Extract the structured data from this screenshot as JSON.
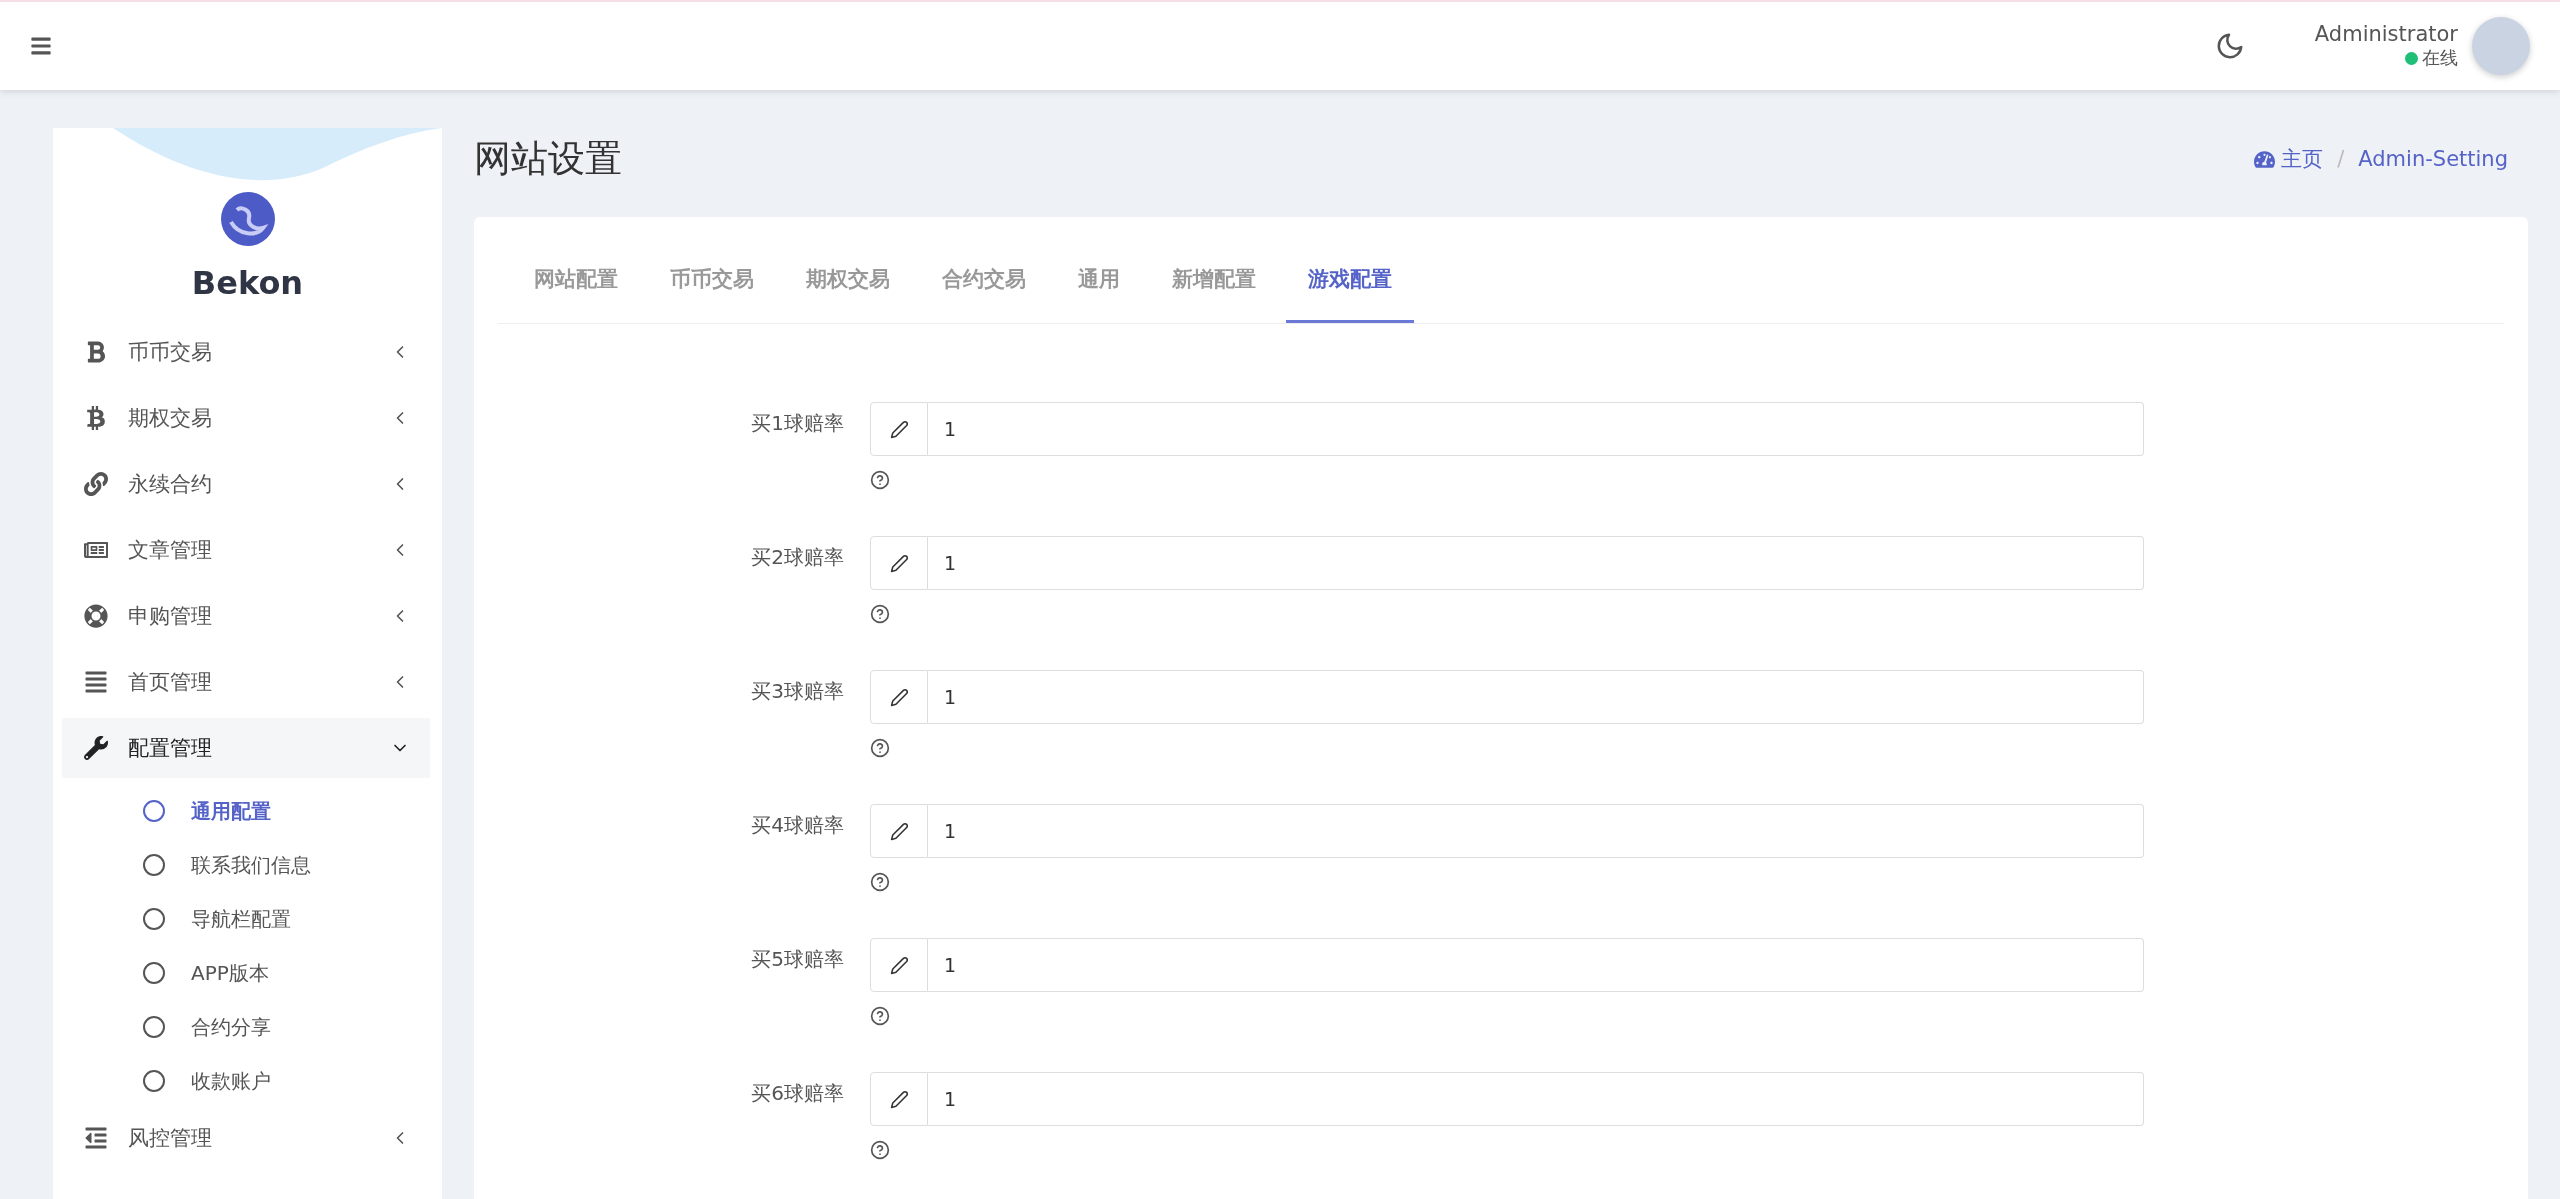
{
  "topbar": {
    "user": {
      "name": "Administrator",
      "status": "在线"
    }
  },
  "sidebar": {
    "brand": "Bekon",
    "items": [
      {
        "kind": "bold-b",
        "label": "币币交易",
        "expanded": false,
        "selected": false
      },
      {
        "kind": "bitcoin",
        "label": "期权交易",
        "expanded": false,
        "selected": false
      },
      {
        "kind": "link",
        "label": "永续合约",
        "expanded": false,
        "selected": false
      },
      {
        "kind": "newspaper",
        "label": "文章管理",
        "expanded": false,
        "selected": false
      },
      {
        "kind": "lifering",
        "label": "申购管理",
        "expanded": false,
        "selected": false
      },
      {
        "kind": "lines",
        "label": "首页管理",
        "expanded": false,
        "selected": false
      },
      {
        "kind": "wrench",
        "label": "配置管理",
        "expanded": true,
        "selected": true,
        "children": [
          {
            "label": "通用配置",
            "selected": true
          },
          {
            "label": "联系我们信息",
            "selected": false
          },
          {
            "label": "导航栏配置",
            "selected": false
          },
          {
            "label": "APP版本",
            "selected": false
          },
          {
            "label": "合约分享",
            "selected": false
          },
          {
            "label": "收款账户",
            "selected": false
          }
        ]
      },
      {
        "kind": "outdent",
        "label": "风控管理",
        "expanded": false,
        "selected": false
      }
    ]
  },
  "page": {
    "title": "网站设置",
    "breadcrumb": [
      "主页",
      "Admin-Setting"
    ],
    "breadcrumb_separator": "/"
  },
  "tabs": [
    {
      "label": "网站配置",
      "selected": false
    },
    {
      "label": "币币交易",
      "selected": false
    },
    {
      "label": "期权交易",
      "selected": false
    },
    {
      "label": "合约交易",
      "selected": false
    },
    {
      "label": "通用",
      "selected": false
    },
    {
      "label": "新增配置",
      "selected": false
    },
    {
      "label": "游戏配置",
      "selected": true
    }
  ],
  "fields": [
    {
      "label": "买1球赔率",
      "value": "1"
    },
    {
      "label": "买2球赔率",
      "value": "1"
    },
    {
      "label": "买3球赔率",
      "value": "1"
    },
    {
      "label": "买4球赔率",
      "value": "1"
    },
    {
      "label": "买5球赔率",
      "value": "1"
    },
    {
      "label": "买6球赔率",
      "value": "1"
    }
  ]
}
